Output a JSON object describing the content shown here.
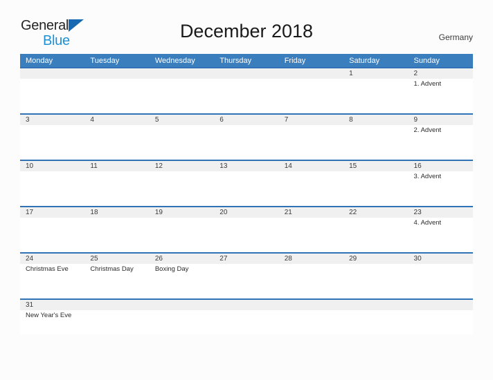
{
  "brand": {
    "word_general": "General",
    "word_blue": "Blue",
    "accent_blue": "#1668b3",
    "light_blue": "#1e90d6"
  },
  "header": {
    "title": "December 2018",
    "region": "Germany"
  },
  "calendar": {
    "header_color": "#3b7ebd",
    "separator_color": "#2f72b5",
    "date_band_color": "#f0f0f0",
    "weekdays": [
      "Monday",
      "Tuesday",
      "Wednesday",
      "Thursday",
      "Friday",
      "Saturday",
      "Sunday"
    ],
    "weeks": [
      {
        "days": [
          {
            "date": "",
            "event": ""
          },
          {
            "date": "",
            "event": ""
          },
          {
            "date": "",
            "event": ""
          },
          {
            "date": "",
            "event": ""
          },
          {
            "date": "",
            "event": ""
          },
          {
            "date": "1",
            "event": ""
          },
          {
            "date": "2",
            "event": "1. Advent"
          }
        ]
      },
      {
        "days": [
          {
            "date": "3",
            "event": ""
          },
          {
            "date": "4",
            "event": ""
          },
          {
            "date": "5",
            "event": ""
          },
          {
            "date": "6",
            "event": ""
          },
          {
            "date": "7",
            "event": ""
          },
          {
            "date": "8",
            "event": ""
          },
          {
            "date": "9",
            "event": "2. Advent"
          }
        ]
      },
      {
        "days": [
          {
            "date": "10",
            "event": ""
          },
          {
            "date": "11",
            "event": ""
          },
          {
            "date": "12",
            "event": ""
          },
          {
            "date": "13",
            "event": ""
          },
          {
            "date": "14",
            "event": ""
          },
          {
            "date": "15",
            "event": ""
          },
          {
            "date": "16",
            "event": "3. Advent"
          }
        ]
      },
      {
        "days": [
          {
            "date": "17",
            "event": ""
          },
          {
            "date": "18",
            "event": ""
          },
          {
            "date": "19",
            "event": ""
          },
          {
            "date": "20",
            "event": ""
          },
          {
            "date": "21",
            "event": ""
          },
          {
            "date": "22",
            "event": ""
          },
          {
            "date": "23",
            "event": "4. Advent"
          }
        ]
      },
      {
        "days": [
          {
            "date": "24",
            "event": "Christmas Eve"
          },
          {
            "date": "25",
            "event": "Christmas Day"
          },
          {
            "date": "26",
            "event": "Boxing Day"
          },
          {
            "date": "27",
            "event": ""
          },
          {
            "date": "28",
            "event": ""
          },
          {
            "date": "29",
            "event": ""
          },
          {
            "date": "30",
            "event": ""
          }
        ]
      },
      {
        "days": [
          {
            "date": "31",
            "event": "New Year's Eve"
          },
          {
            "date": "",
            "event": ""
          },
          {
            "date": "",
            "event": ""
          },
          {
            "date": "",
            "event": ""
          },
          {
            "date": "",
            "event": ""
          },
          {
            "date": "",
            "event": ""
          },
          {
            "date": "",
            "event": ""
          }
        ]
      }
    ]
  }
}
